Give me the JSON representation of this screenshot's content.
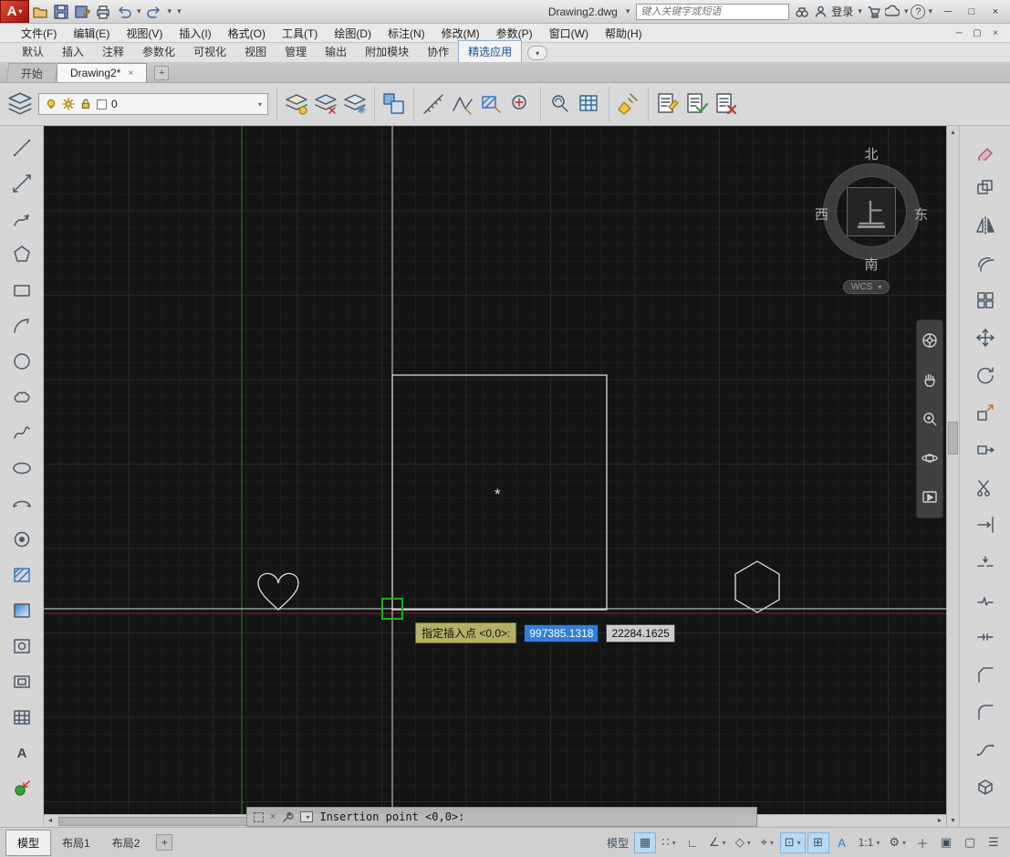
{
  "glyphs": {
    "caret": "▾",
    "close": "×",
    "plus": "+",
    "minimize": "─",
    "maximize": "□",
    "restore": "▢",
    "help": "?",
    "asterisk": "*",
    "up": "▲",
    "down": "▼",
    "left": "◄",
    "right": "►"
  },
  "titlebar": {
    "app_initial": "A",
    "title": "Drawing2.dwg",
    "search_placeholder": "键入关键字或短语",
    "signin_label": "登录"
  },
  "menubar": {
    "items": [
      "文件(F)",
      "编辑(E)",
      "视图(V)",
      "插入(I)",
      "格式(O)",
      "工具(T)",
      "绘图(D)",
      "标注(N)",
      "修改(M)",
      "参数(P)",
      "窗口(W)",
      "帮助(H)"
    ]
  },
  "ribbon": {
    "tabs": [
      "默认",
      "插入",
      "注释",
      "参数化",
      "可视化",
      "视图",
      "管理",
      "输出",
      "附加模块",
      "协作",
      "精选应用"
    ],
    "active_tab": "精选应用"
  },
  "filetabs": {
    "start": "开始",
    "drawing": "Drawing2*"
  },
  "layer_panel": {
    "current_layer": "0"
  },
  "viewcube": {
    "north": "北",
    "south": "南",
    "east": "东",
    "west": "西",
    "top": "上",
    "wcs": "WCS"
  },
  "dynamic_input": {
    "prompt": "指定插入点 <0,0>:",
    "x_value": "997385.1318",
    "y_value": "22284.1625"
  },
  "command_line": {
    "prompt": "Insertion point <0,0>:"
  },
  "layout_tabs": {
    "model": "模型",
    "layout1": "布局1",
    "layout2": "布局2"
  },
  "statusbar": {
    "model_label": "模型",
    "grid": "▦",
    "snap": "∷",
    "ortho": "∟",
    "polar": "∠",
    "iso": "◇",
    "otrack": "⌖",
    "osnap": "⊡",
    "dyn_input": "⊞",
    "annotation": "A",
    "scale": "1:1",
    "workspace": "⚙",
    "add": "＋",
    "monitor": "▣",
    "isolate": "▢",
    "customize": "☰"
  },
  "tools": {
    "draw": [
      "line",
      "construction-line",
      "polyline",
      "polygon",
      "rectangle",
      "arc",
      "circle",
      "revision-cloud",
      "spline",
      "ellipse",
      "ellipse-arc",
      "donut",
      "hatch",
      "gradient",
      "boundary",
      "region",
      "table",
      "text",
      "point"
    ],
    "modify": [
      "erase",
      "copy",
      "mirror",
      "offset",
      "array",
      "move",
      "rotate",
      "scale",
      "stretch",
      "trim",
      "extend",
      "break-at-point",
      "break",
      "join",
      "chamfer",
      "fillet",
      "blend-curves",
      "explode"
    ],
    "navbar": [
      "navigation-wheel",
      "pan",
      "zoom",
      "orbit",
      "showmotion"
    ]
  },
  "colors": {
    "app_red": "#c2271d",
    "canvas_bg": "#141414",
    "axis_green": "#1e8c1e",
    "axis_red": "#8c1e1e",
    "snap_green": "#19b219",
    "selection_blue": "#2f80d9",
    "tooltip_olive": "#b3b06a"
  }
}
